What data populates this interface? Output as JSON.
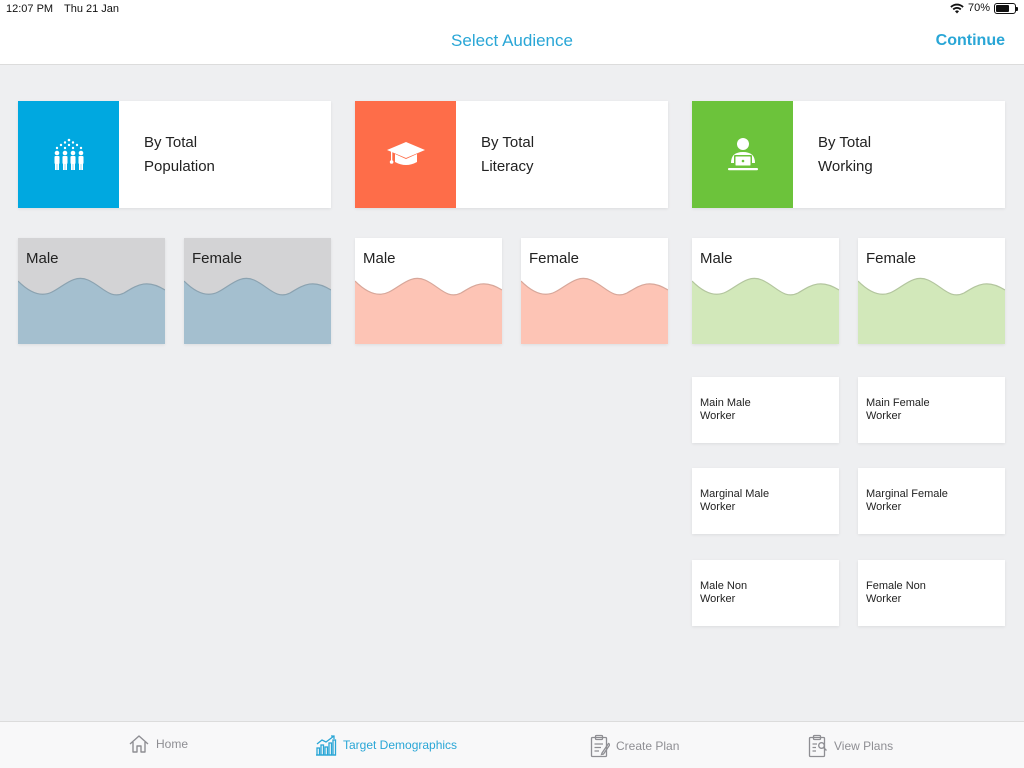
{
  "status_bar": {
    "time": "12:07 PM",
    "date": "Thu 21 Jan",
    "battery_percent": "70%",
    "battery_level": 0.7,
    "icons": [
      "wifi-icon",
      "battery-icon"
    ]
  },
  "nav": {
    "title": "Select Audience",
    "continue_label": "Continue"
  },
  "categories": [
    {
      "line1": "By Total",
      "line2": "Population",
      "icon": "population-icon",
      "color": "#00a8e0"
    },
    {
      "line1": "By Total",
      "line2": "Literacy",
      "icon": "graduation-cap-icon",
      "color": "#fe6d49"
    },
    {
      "line1": "By Total",
      "line2": "Working",
      "icon": "worker-laptop-icon",
      "color": "#6cc33b"
    }
  ],
  "gender_options": {
    "population": {
      "male": "Male",
      "female": "Female",
      "top_color": "#d3d3d5",
      "wave_color": "#a4bfcf"
    },
    "literacy": {
      "male": "Male",
      "female": "Female",
      "top_color": "#ffffff",
      "wave_color": "#fdc4b5"
    },
    "working": {
      "male": "Male",
      "female": "Female",
      "top_color": "#ffffff",
      "wave_color": "#d2e8ba"
    }
  },
  "worker_options": [
    {
      "line1": "Main Male",
      "line2": "Worker"
    },
    {
      "line1": "Main Female",
      "line2": "Worker"
    },
    {
      "line1": "Marginal Male",
      "line2": "Worker"
    },
    {
      "line1": "Marginal Female",
      "line2": "Worker"
    },
    {
      "line1": "Male Non",
      "line2": "Worker"
    },
    {
      "line1": "Female Non",
      "line2": "Worker"
    }
  ],
  "tabs": [
    {
      "label": "Home",
      "icon": "home-icon",
      "active": false
    },
    {
      "label": "Target Demographics",
      "icon": "chart-icon",
      "active": true
    },
    {
      "label": "Create Plan",
      "icon": "clipboard-edit-icon",
      "active": false
    },
    {
      "label": "View Plans",
      "icon": "clipboard-view-icon",
      "active": false
    }
  ],
  "colors": {
    "accent": "#29a6d6",
    "background": "#eeeff1",
    "tab_inactive": "#8e8e93"
  }
}
